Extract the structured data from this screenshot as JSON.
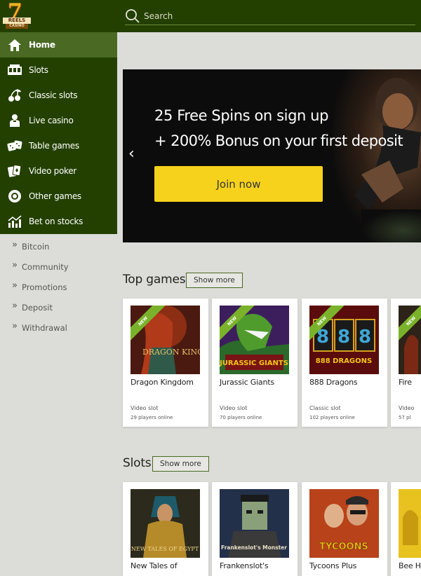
{
  "brand": {
    "seven": "7",
    "reels": "REELS",
    "casino": "CASINO"
  },
  "search": {
    "placeholder": "Search",
    "icon": "search-icon"
  },
  "nav": {
    "home": {
      "label": "Home",
      "icon": "home-icon"
    },
    "items": [
      {
        "label": "Slots",
        "icon": "slot-machine-icon"
      },
      {
        "label": "Classic slots",
        "icon": "cherries-icon"
      },
      {
        "label": "Live casino",
        "icon": "dealer-icon"
      },
      {
        "label": "Table games",
        "icon": "dice-icon"
      },
      {
        "label": "Video poker",
        "icon": "cards-icon"
      },
      {
        "label": "Other games",
        "icon": "chip-icon"
      },
      {
        "label": "Bet on stocks",
        "icon": "stock-chart-icon"
      }
    ],
    "links": [
      {
        "label": "Bitcoin"
      },
      {
        "label": "Community"
      },
      {
        "label": "Promotions"
      },
      {
        "label": "Deposit"
      },
      {
        "label": "Withdrawal"
      }
    ],
    "chevron": "»"
  },
  "banner": {
    "line1": "25 Free Spins on sign up",
    "line2": "+ 200% Bonus on your first deposit",
    "cta": "Join now",
    "prev_arrow": "‹"
  },
  "sections": {
    "top_games": {
      "title": "Top games",
      "show_more": "Show more",
      "games": [
        {
          "name": "Dragon Kingdom",
          "type": "Video slot",
          "online": "29 players online",
          "badge": "NEW"
        },
        {
          "name": "Jurassic Giants",
          "type": "Video slot",
          "online": "70 players online",
          "badge": "NEW"
        },
        {
          "name": "888 Dragons",
          "type": "Classic slot",
          "online": "102 players online",
          "badge": "NEW"
        },
        {
          "name": "Fire",
          "type": "Video",
          "online": "57 pl",
          "badge": "NEW"
        }
      ]
    },
    "slots": {
      "title": "Slots",
      "show_more": "Show more",
      "games": [
        {
          "name": "New Tales of",
          "art_text": "NEW TALES OF EGYPT"
        },
        {
          "name": "Frankenslot's",
          "art_text": "Frankenslot's Monster"
        },
        {
          "name": "Tycoons Plus",
          "art_text": "TYCOONS"
        },
        {
          "name": "Bee H"
        }
      ]
    }
  },
  "game_art": {
    "dragon_kingdom": "DRAGON KINGDOM",
    "jurassic_giants": "JURASSIC GIANTS",
    "dragons_888": "888 DRAGONS"
  },
  "colors": {
    "header": "#234001",
    "nav_active": "#4a6a24",
    "cta": "#f6d21c",
    "badge": "#7ab32b",
    "page_bg": "#dcdcd8"
  }
}
